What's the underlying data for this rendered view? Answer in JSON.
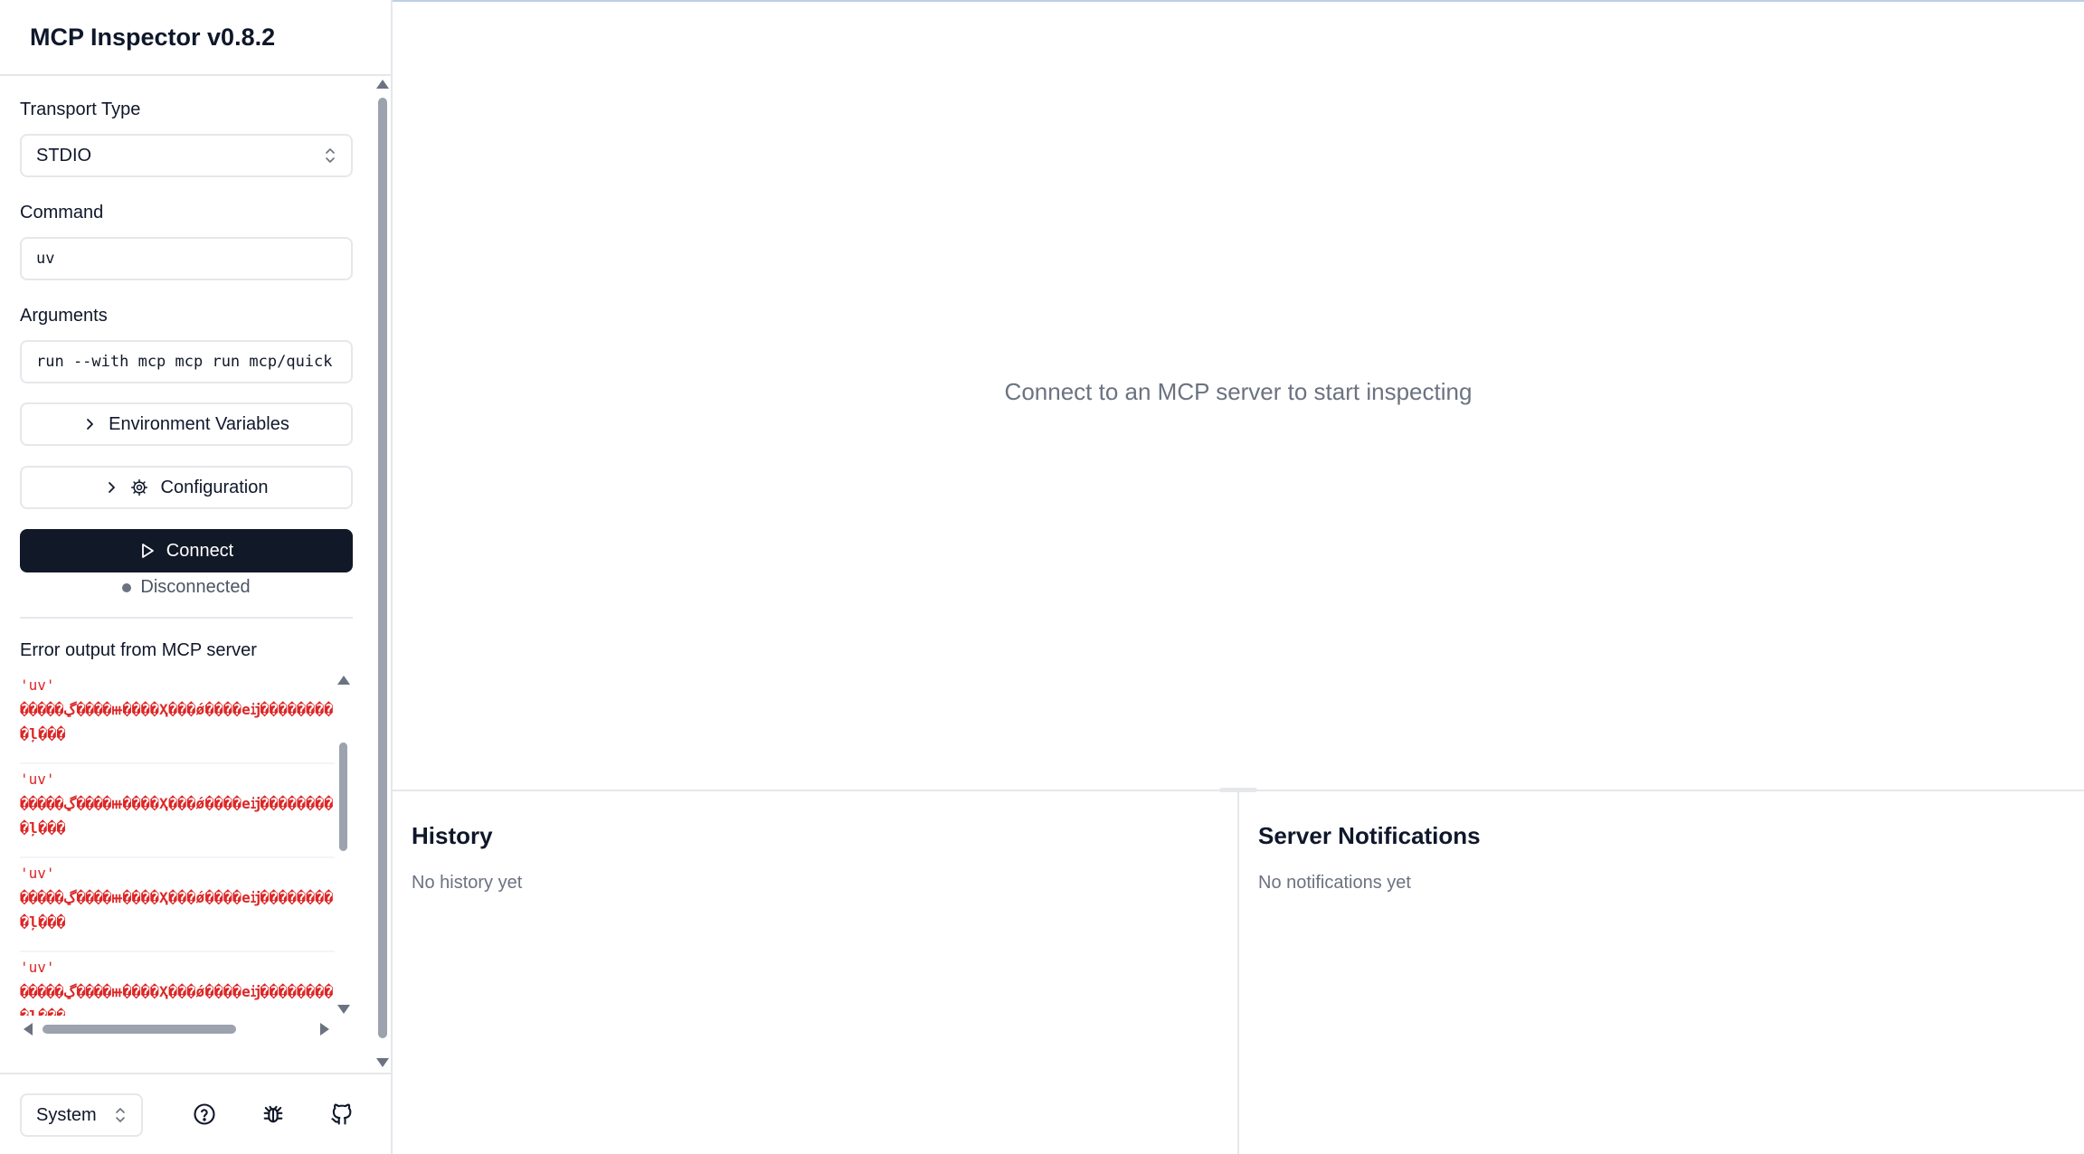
{
  "app": {
    "title": "MCP Inspector v0.8.2"
  },
  "sidebar": {
    "transport_label": "Transport Type",
    "transport_value": "STDIO",
    "command_label": "Command",
    "command_value": "uv",
    "arguments_label": "Arguments",
    "arguments_value": "run --with mcp mcp run mcp/quick",
    "env_button": "Environment Variables",
    "config_button": "Configuration",
    "connect_button": "Connect",
    "status_text": "Disconnected",
    "error_title": "Error output from MCP server",
    "errors": [
      {
        "code": "'uv'",
        "message": "�����ڲ����ⲿ����Ҳ���ǿ����еĳ���������ļ���"
      },
      {
        "code": "'uv'",
        "message": "�����ڲ����ⲿ����Ҳ���ǿ����еĳ���������ļ���"
      },
      {
        "code": "'uv'",
        "message": "�����ڲ����ⲿ����Ҳ���ǿ����еĳ���������ļ���"
      },
      {
        "code": "'uv'",
        "message": "�����ڲ����ⲿ����Ҳ���ǿ����еĳ���������ļ���"
      }
    ]
  },
  "footer": {
    "theme_value": "System"
  },
  "main": {
    "empty_message": "Connect to an MCP server to start inspecting",
    "history_title": "History",
    "history_empty": "No history yet",
    "notifications_title": "Server Notifications",
    "notifications_empty": "No notifications yet"
  },
  "icons": {
    "help": "help-circle-icon",
    "bug": "bug-icon",
    "github": "github-icon",
    "gear": "gear-icon",
    "play": "play-icon"
  },
  "colors": {
    "connect_bg": "#111827",
    "error_text": "#dc2626",
    "border": "#e5e7eb"
  }
}
